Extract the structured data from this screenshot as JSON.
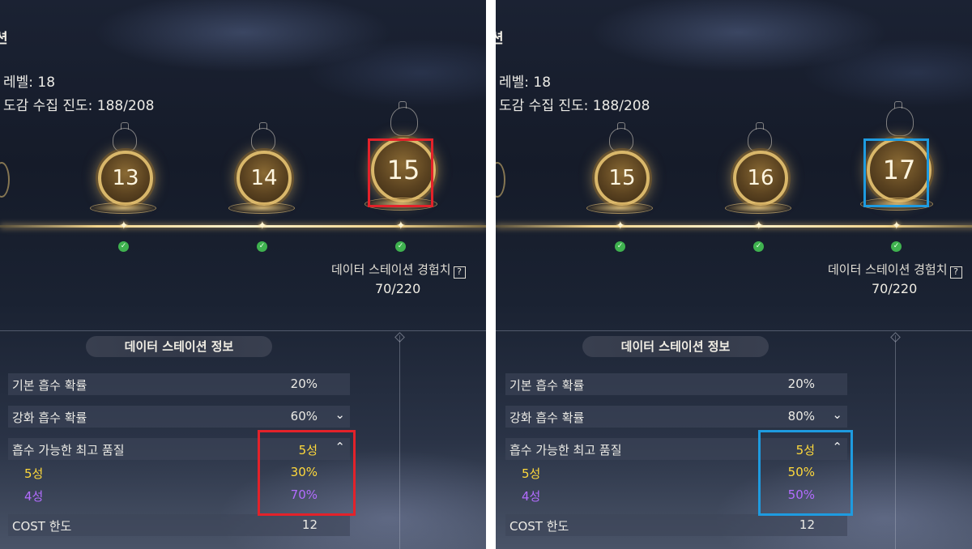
{
  "left": {
    "title": "션",
    "level_text": "레벨: 18",
    "collection_text": "도감 수집 진도: 188/208",
    "stations": [
      "13",
      "14",
      "15"
    ],
    "exp_label": "데이터 스테이션 경험치",
    "exp_value": "70/220",
    "section_title": "데이터 스테이션 정보",
    "rows": [
      {
        "label": "기본 흡수 확률",
        "value": "20%"
      },
      {
        "label": "강화 흡수 확률",
        "value": "60%"
      },
      {
        "label": "흡수 가능한 최고 품질",
        "value": "5성"
      },
      {
        "label": "5성",
        "value": "30%"
      },
      {
        "label": "4성",
        "value": "70%"
      },
      {
        "label": "COST 한도",
        "value": "12"
      }
    ],
    "highlight_color": "#e3222a"
  },
  "right": {
    "title": "션",
    "level_text": "레벨: 18",
    "collection_text": "도감 수집 진도: 188/208",
    "stations": [
      "15",
      "16",
      "17"
    ],
    "exp_label": "데이터 스테이션 경험치",
    "exp_value": "70/220",
    "section_title": "데이터 스테이션 정보",
    "rows": [
      {
        "label": "기본 흡수 확률",
        "value": "20%"
      },
      {
        "label": "강화 흡수 확률",
        "value": "80%"
      },
      {
        "label": "흡수 가능한 최고 품질",
        "value": "5성"
      },
      {
        "label": "5성",
        "value": "50%"
      },
      {
        "label": "4성",
        "value": "50%"
      },
      {
        "label": "COST 한도",
        "value": "12"
      }
    ],
    "highlight_color": "#1e9be0"
  },
  "icons": {
    "help": "?",
    "check": "✓",
    "chevron_down": "⌄",
    "chevron_up": "⌃",
    "spark": "✦"
  },
  "colors": {
    "grade5": "#ffd93b",
    "grade4": "#b36cff",
    "check": "#3fb24f"
  }
}
